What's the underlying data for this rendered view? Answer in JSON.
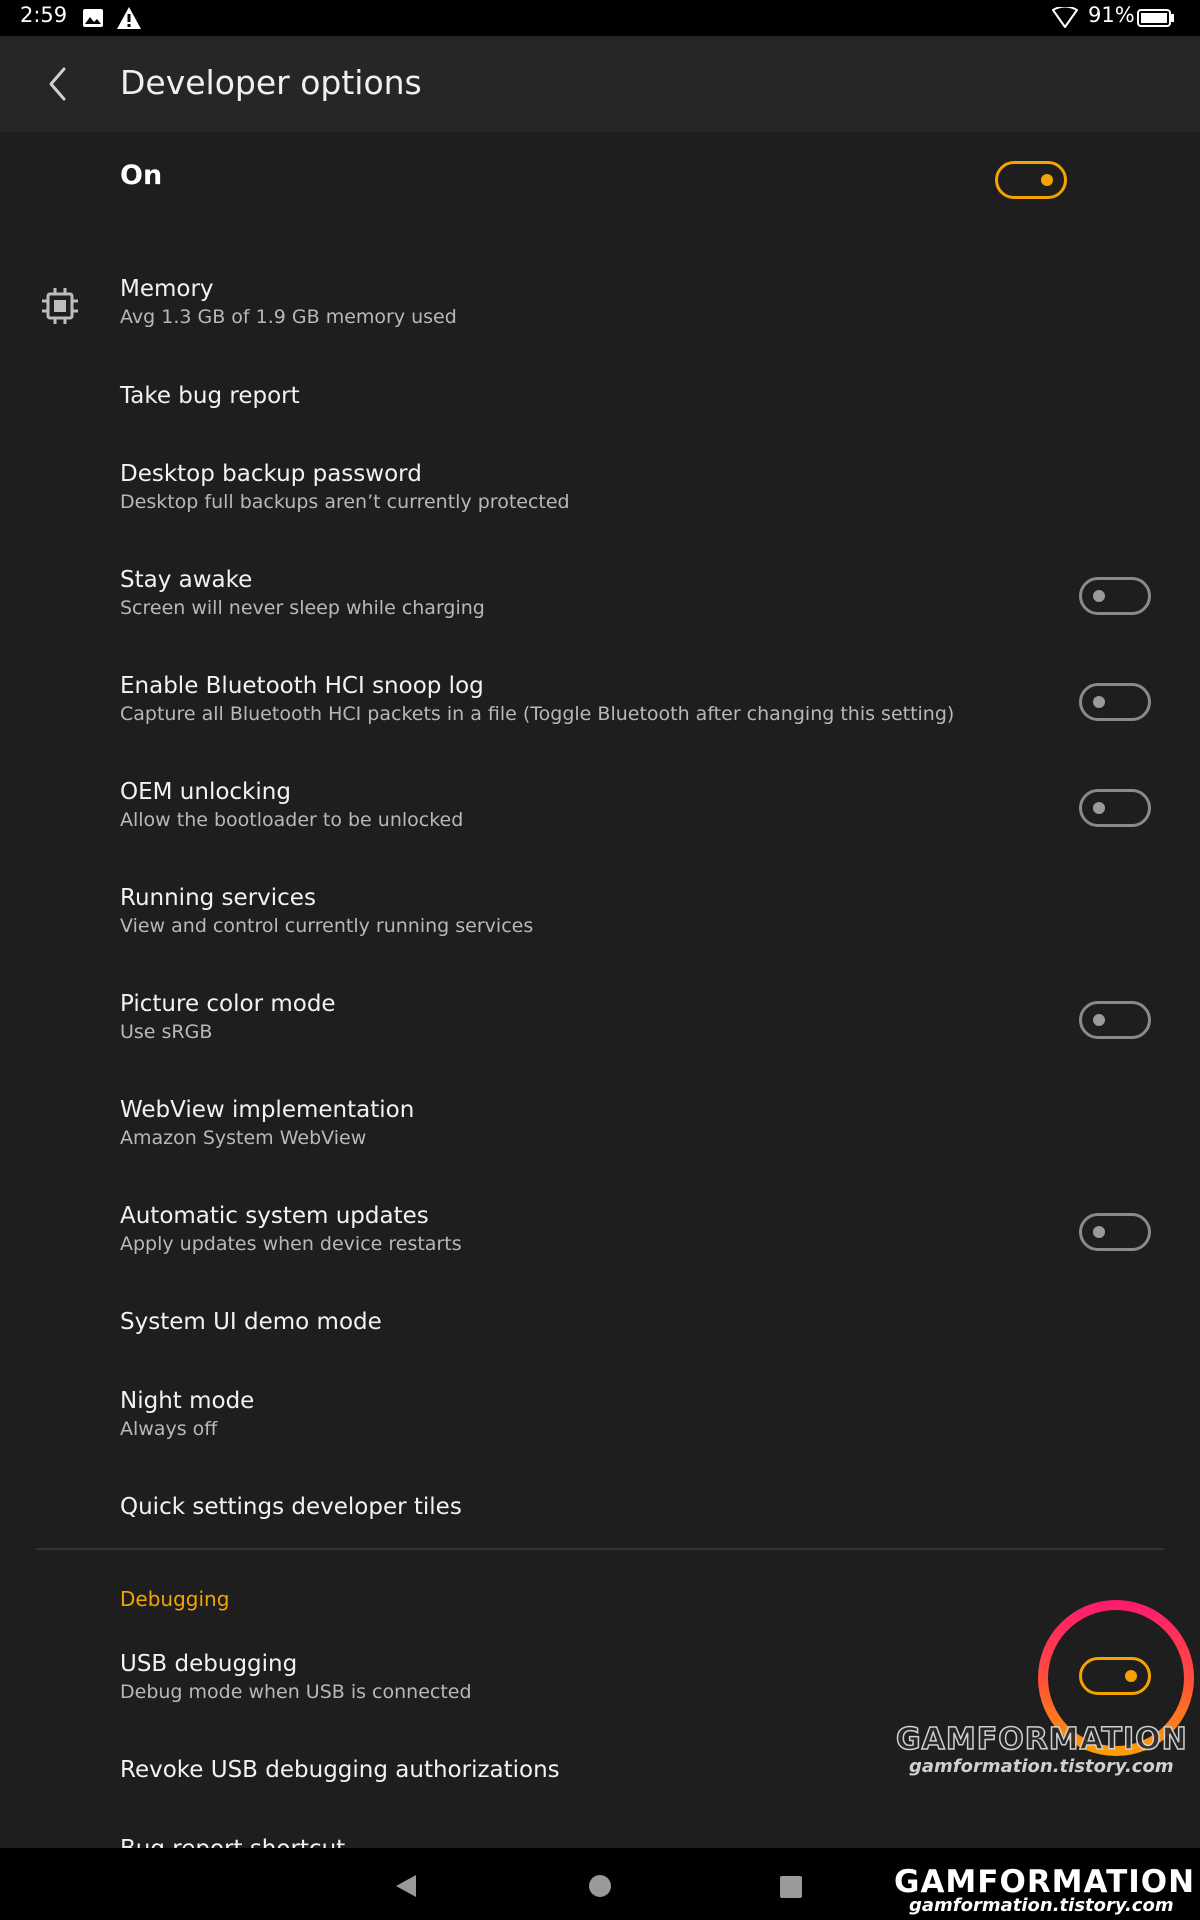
{
  "status_bar": {
    "time": "2:59",
    "battery_percent": "91%",
    "battery_level": 0.91,
    "icons": [
      "image-notification-icon",
      "warning-icon",
      "wifi-icon",
      "battery-icon"
    ]
  },
  "header": {
    "title": "Developer options",
    "back_icon": "chevron-left-icon"
  },
  "master_switch": {
    "label": "On",
    "checked": true
  },
  "prefs": {
    "memory": {
      "title": "Memory",
      "summary": "Avg 1.3 GB of 1.9 GB memory used",
      "icon": "memory-chip-icon"
    },
    "bug_report": {
      "title": "Take bug report"
    },
    "backup_password": {
      "title": "Desktop backup password",
      "summary": "Desktop full backups aren’t currently protected"
    },
    "stay_awake": {
      "title": "Stay awake",
      "summary": "Screen will never sleep while charging",
      "checked": false
    },
    "bt_snoop": {
      "title": "Enable Bluetooth HCI snoop log",
      "summary": "Capture all Bluetooth HCI packets in a file (Toggle Bluetooth after changing this setting)",
      "checked": false
    },
    "oem_unlock": {
      "title": "OEM unlocking",
      "summary": "Allow the bootloader to be unlocked",
      "checked": false
    },
    "running_services": {
      "title": "Running services",
      "summary": "View and control currently running services"
    },
    "color_mode": {
      "title": "Picture color mode",
      "summary": "Use sRGB",
      "checked": false
    },
    "webview": {
      "title": "WebView implementation",
      "summary": "Amazon System WebView"
    },
    "auto_updates": {
      "title": "Automatic system updates",
      "summary": "Apply updates when device restarts",
      "checked": false
    },
    "demo_mode": {
      "title": "System UI demo mode"
    },
    "night_mode": {
      "title": "Night mode",
      "summary": "Always off"
    },
    "qs_tiles": {
      "title": "Quick settings developer tiles"
    }
  },
  "debugging": {
    "header": "Debugging",
    "usb_debugging": {
      "title": "USB debugging",
      "summary": "Debug mode when USB is connected",
      "checked": true
    },
    "revoke_auth": {
      "title": "Revoke USB debugging authorizations"
    },
    "bug_shortcut": {
      "title": "Bug report shortcut"
    }
  },
  "watermark": {
    "brand": "GAMFORMATION",
    "url": "gamformation.tistory.com"
  },
  "nav_bar": {
    "icons": [
      "back-triangle-icon",
      "home-circle-icon",
      "recents-square-icon"
    ]
  },
  "colors": {
    "accent": "#f4a300",
    "background": "#1e1e1e",
    "app_bar": "#262626",
    "highlight_ring_top": "#ff1a70",
    "highlight_ring_bottom": "#ffa000"
  }
}
